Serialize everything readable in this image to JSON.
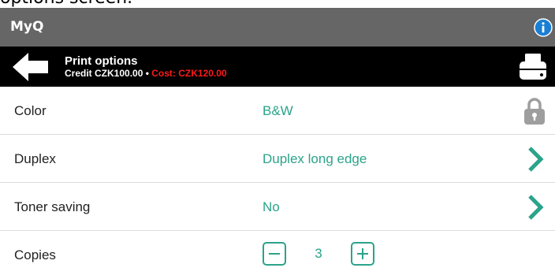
{
  "caption": "options screen.",
  "app": {
    "title": "MyQ"
  },
  "header": {
    "title": "Print options",
    "credit": "Credit CZK100.00",
    "separator": " • ",
    "cost": "Cost: CZK120.00"
  },
  "options": [
    {
      "label": "Color",
      "value": "B&W",
      "icon": "lock-icon"
    },
    {
      "label": "Duplex",
      "value": "Duplex long edge",
      "icon": "chevron-right-icon"
    },
    {
      "label": "Toner saving",
      "value": "No",
      "icon": "chevron-right-icon"
    },
    {
      "label": "Copies",
      "value": "3"
    }
  ],
  "colors": {
    "topbar": "#666666",
    "header": "#000000",
    "accent": "#2ba38a",
    "cost": "#ff1a1a",
    "info": "#1a7fd4"
  }
}
